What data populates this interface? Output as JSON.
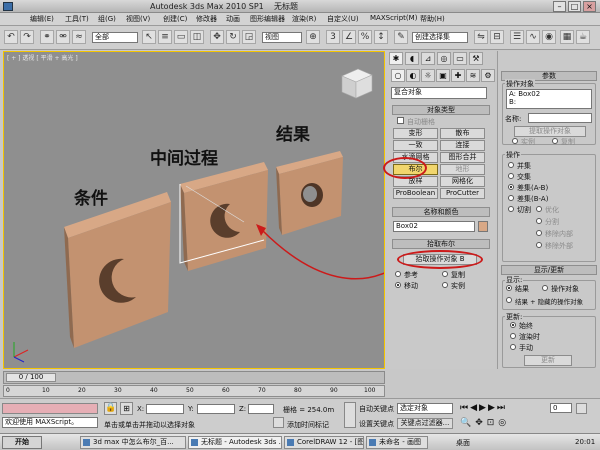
{
  "window": {
    "app_title": "Autodesk 3ds Max  2010 SP1",
    "doc_title": "无标题"
  },
  "menu": [
    "编辑(E)",
    "工具(T)",
    "组(G)",
    "视图(V)",
    "创建(C)",
    "修改器",
    "动画",
    "图形编辑器",
    "渲染(R)",
    "自定义(U)",
    "MAXScript(M)",
    "帮助(H)"
  ],
  "toolbar": {
    "selection_filter": "全部",
    "ref_coord": "视图",
    "named_selection": "创建选择集"
  },
  "viewport": {
    "label": "[ + ] 透视 [ 平滑 + 高光 ]",
    "annotations": {
      "condition": "条件",
      "intermediate": "中间过程",
      "result": "结果"
    }
  },
  "command_panel": {
    "category": "复合对象",
    "object_type_title": "对象类型",
    "auto_grid": "自动栅格",
    "buttons": [
      "变形",
      "散布",
      "一致",
      "连接",
      "水滴网格",
      "图形合并",
      "布尔",
      "地形",
      "放样",
      "网格化",
      "ProBoolean",
      "ProCutter"
    ],
    "name_color_title": "名称和颜色",
    "object_name": "Box02",
    "pick_boolean_title": "拾取布尔",
    "pick_operand_btn": "拾取操作对象 B",
    "ref_options": [
      "参考",
      "复制",
      "移动",
      "实例"
    ]
  },
  "params_panel": {
    "title": "参数",
    "operands_label": "操作对象",
    "operands": [
      "A: Box02",
      "B:"
    ],
    "name_label": "名称:",
    "extract_btn": "提取操作对象",
    "extract_opts": [
      "实例",
      "复制"
    ],
    "operation_label": "操作",
    "operations": [
      "并集",
      "交集",
      "差集(A-B)",
      "差集(B-A)",
      "切割"
    ],
    "cut_options": [
      "优化",
      "分割",
      "移除内部",
      "移除外部"
    ],
    "display_update_title": "显示/更新",
    "display_label": "显示:",
    "display_opts": [
      "结果",
      "操作对象",
      "结果 + 隐藏的操作对象"
    ],
    "update_label": "更新:",
    "update_opts": [
      "始终",
      "渲染时",
      "手动"
    ],
    "update_btn": "更新"
  },
  "timeline": {
    "slider_label": "0 / 100",
    "ticks": [
      "0",
      "10",
      "20",
      "30",
      "40",
      "50",
      "60",
      "70",
      "80",
      "90",
      "100"
    ]
  },
  "status": {
    "maxscript_welcome": "欢迎使用  MAXScript。",
    "prompt": "单击或单击并拖动以选择对象",
    "add_time_tag": "添加时间标记",
    "x_label": "X:",
    "y_label": "Y:",
    "z_label": "Z:",
    "grid": "栅格 = 254.0m",
    "auto_key": "自动关键点",
    "set_key": "设置关键点",
    "selected_obj": "选定对象",
    "key_filters": "关键点过滤器...",
    "frame": "0"
  },
  "taskbar": {
    "start": "开始",
    "tasks": [
      "3d max 中怎么布尔_百...",
      "无标题 - Autodesk 3ds ...",
      "CorelDRAW 12 - [图形1]",
      "未命名 - 画图"
    ],
    "tray_label": "桌面",
    "clock": "20:01"
  }
}
